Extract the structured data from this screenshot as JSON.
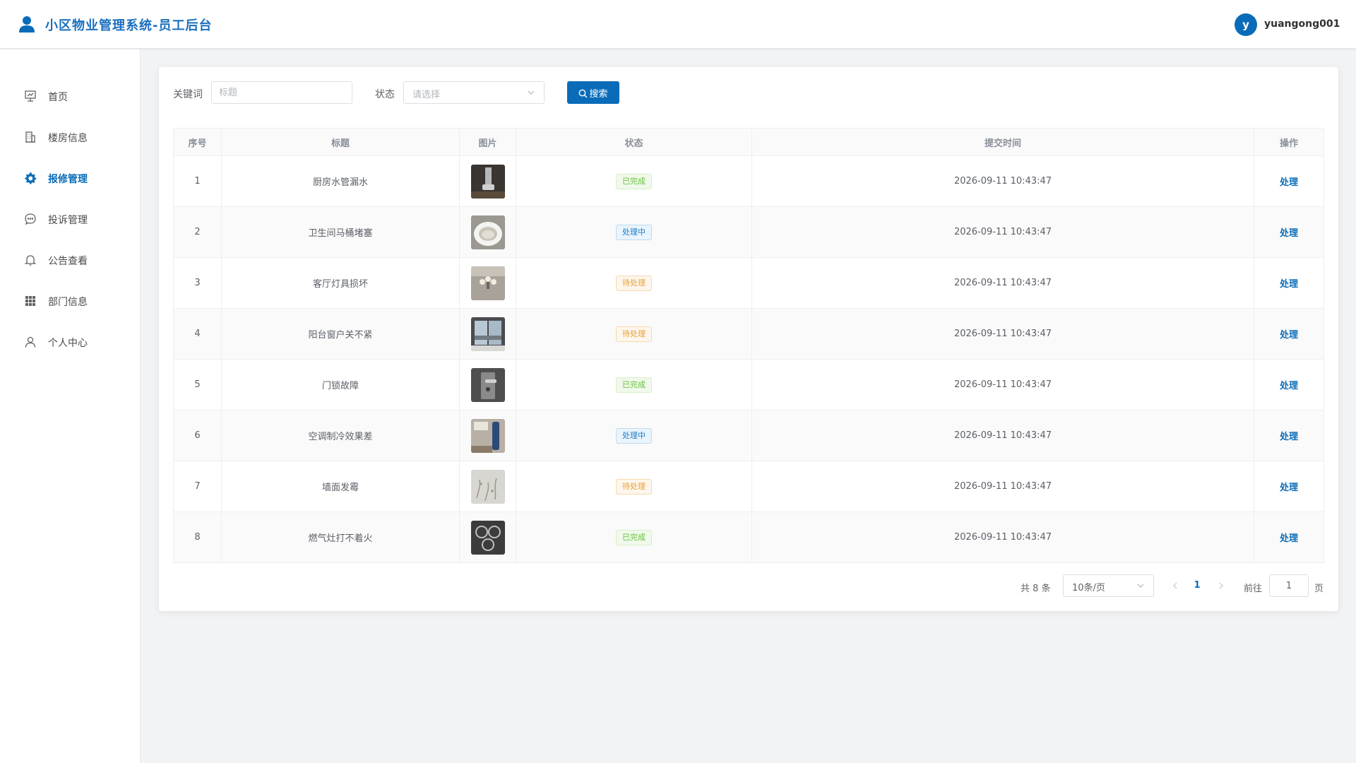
{
  "header": {
    "title": "小区物业管理系统-员工后台",
    "avatar_letter": "y",
    "username": "yuangong001"
  },
  "colors": {
    "accent": "#0a6cb8",
    "done": "#67c23a",
    "doing": "#1a7ec8",
    "todo": "#e6a23c"
  },
  "sidebar": {
    "items": [
      {
        "label": "首页",
        "icon": "dashboard-icon"
      },
      {
        "label": "楼房信息",
        "icon": "building-icon"
      },
      {
        "label": "报修管理",
        "icon": "gear-icon",
        "active": true
      },
      {
        "label": "投诉管理",
        "icon": "chat-bubble-icon"
      },
      {
        "label": "公告查看",
        "icon": "bell-icon"
      },
      {
        "label": "部门信息",
        "icon": "grid-icon"
      },
      {
        "label": "个人中心",
        "icon": "user-icon"
      }
    ]
  },
  "filters": {
    "keyword_label": "关键词",
    "keyword_placeholder": "标题",
    "status_label": "状态",
    "status_placeholder": "请选择",
    "search_label": "搜索"
  },
  "table": {
    "columns": [
      "序号",
      "标题",
      "图片",
      "状态",
      "提交时间",
      "操作"
    ],
    "rows": [
      {
        "no": "1",
        "title": "厨房水管漏水",
        "image": "pipe-photo",
        "status": "已完成",
        "status_kind": "done",
        "time": "2026-09-11 10:43:47",
        "action": "处理"
      },
      {
        "no": "2",
        "title": "卫生间马桶堵塞",
        "image": "toilet-photo",
        "status": "处理中",
        "status_kind": "doing",
        "time": "2026-09-11 10:43:47",
        "action": "处理"
      },
      {
        "no": "3",
        "title": "客厅灯具损坏",
        "image": "lamp-photo",
        "status": "待处理",
        "status_kind": "todo",
        "time": "2026-09-11 10:43:47",
        "action": "处理"
      },
      {
        "no": "4",
        "title": "阳台窗户关不紧",
        "image": "window-photo",
        "status": "待处理",
        "status_kind": "todo",
        "time": "2026-09-11 10:43:47",
        "action": "处理"
      },
      {
        "no": "5",
        "title": "门锁故障",
        "image": "lock-photo",
        "status": "已完成",
        "status_kind": "done",
        "time": "2026-09-11 10:43:47",
        "action": "处理"
      },
      {
        "no": "6",
        "title": "空调制冷效果差",
        "image": "ac-photo",
        "status": "处理中",
        "status_kind": "doing",
        "time": "2026-09-11 10:43:47",
        "action": "处理"
      },
      {
        "no": "7",
        "title": "墙面发霉",
        "image": "wall-photo",
        "status": "待处理",
        "status_kind": "todo",
        "time": "2026-09-11 10:43:47",
        "action": "处理"
      },
      {
        "no": "8",
        "title": "燃气灶打不着火",
        "image": "stove-photo",
        "status": "已完成",
        "status_kind": "done",
        "time": "2026-09-11 10:43:47",
        "action": "处理"
      }
    ]
  },
  "pagination": {
    "total": "共 8 条",
    "page_size": "10条/页",
    "current_page": "1",
    "goto_label": "前往",
    "goto_value": "1",
    "page_suffix": "页"
  }
}
